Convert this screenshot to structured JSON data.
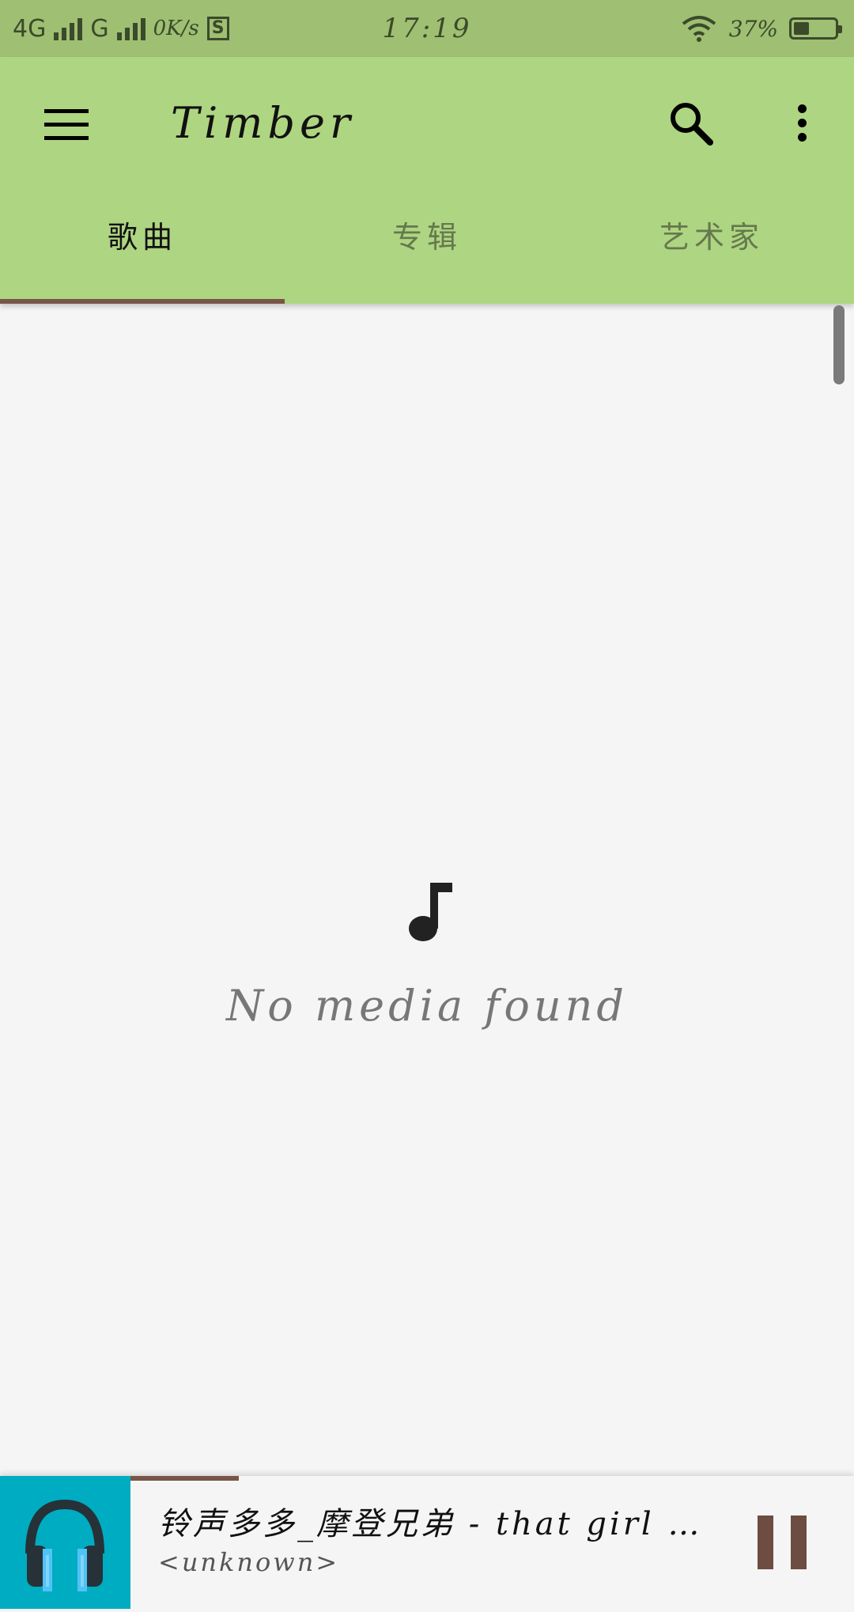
{
  "status_bar": {
    "network1": "4G",
    "network2": "G",
    "speed": "0K/s",
    "sim_label": "S",
    "time": "17:19",
    "battery_percent": "37%",
    "battery_level": 0.37
  },
  "app_bar": {
    "title": "Timber",
    "menu_icon": "hamburger-menu-icon",
    "search_icon": "search-icon",
    "more_icon": "more-vert-icon"
  },
  "tabs": [
    {
      "label": "歌曲",
      "active": true
    },
    {
      "label": "专辑",
      "active": false
    },
    {
      "label": "艺术家",
      "active": false
    }
  ],
  "empty_state": {
    "icon": "music-note-icon",
    "message": "No media found"
  },
  "now_playing": {
    "title": "铃声多多_摩登兄弟 - that girl …",
    "artist": "<unknown>",
    "art_icon": "headphones-icon",
    "pause_icon": "pause-icon",
    "progress": 0.15
  },
  "colors": {
    "status_bar": "#9fbf73",
    "primary": "#aed581",
    "accent": "#795548",
    "art_background": "#00acc1",
    "background": "#f5f5f5"
  }
}
